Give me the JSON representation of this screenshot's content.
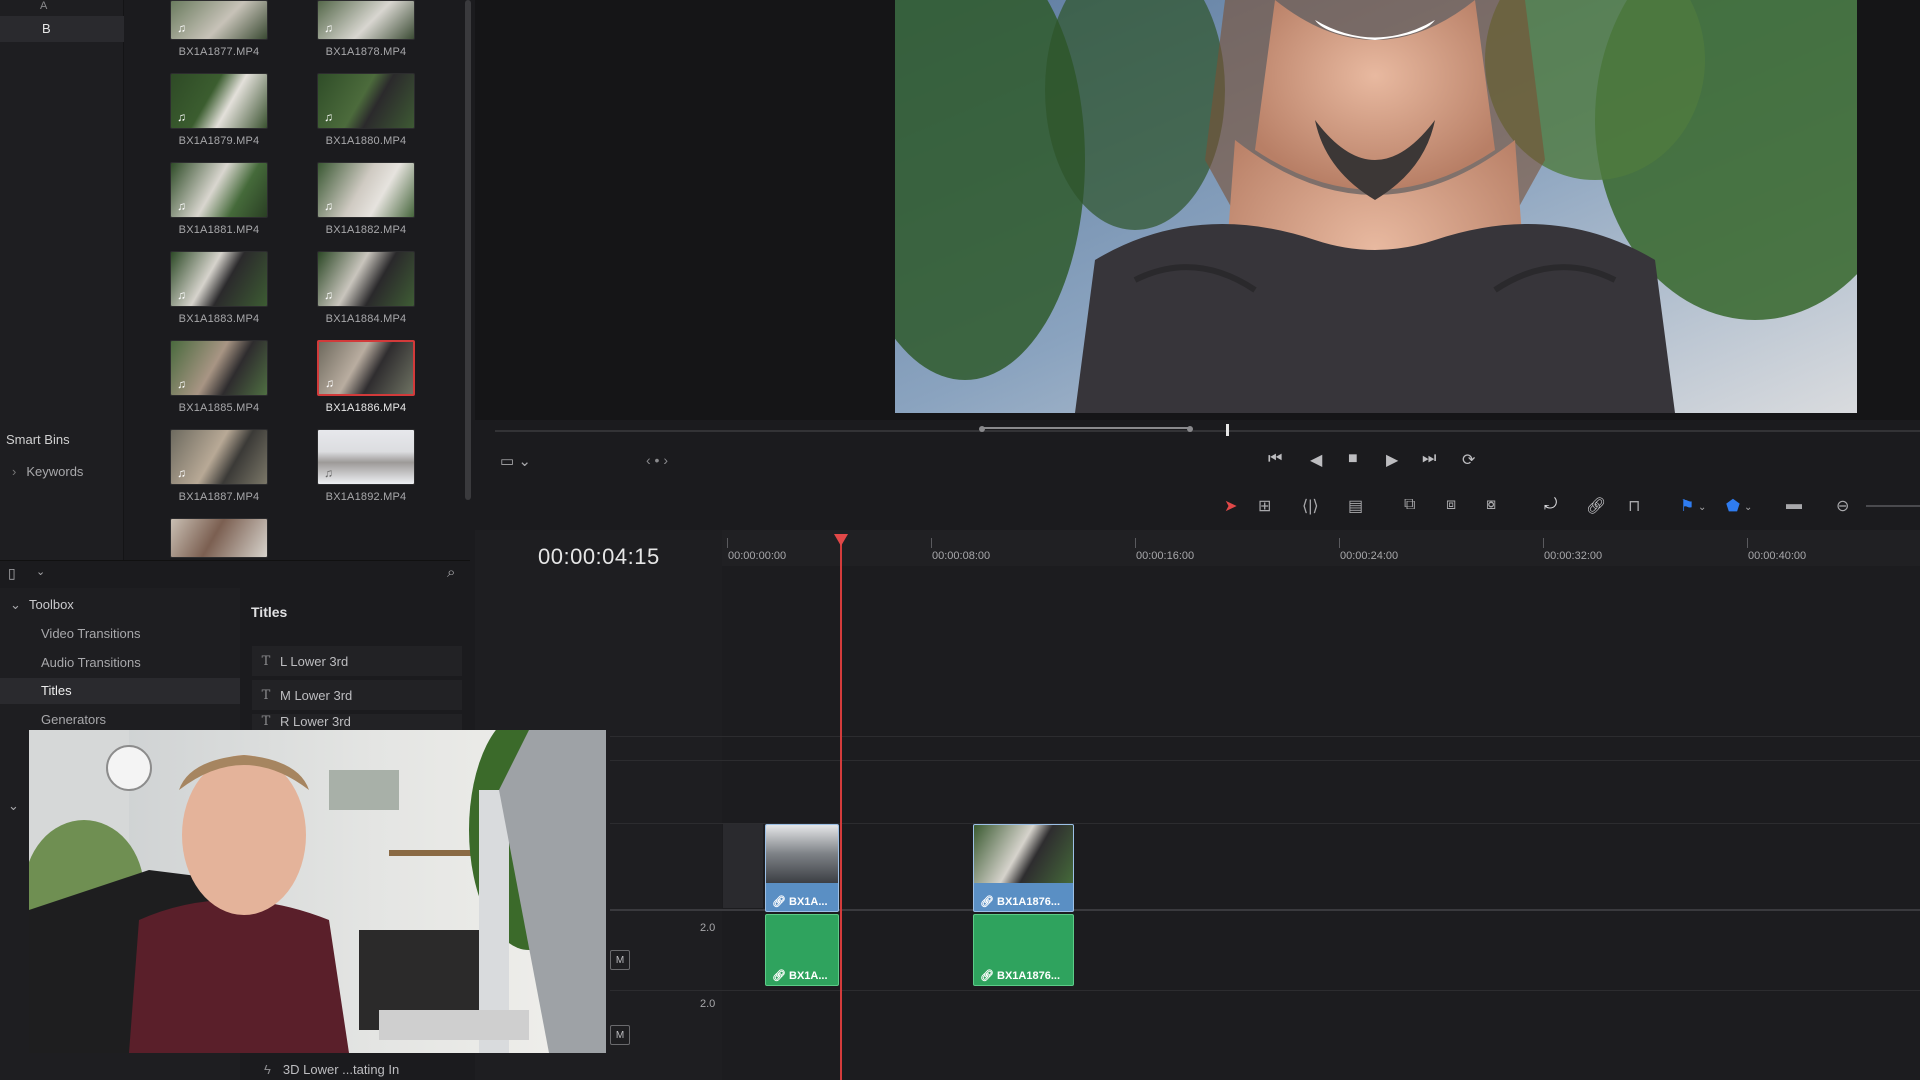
{
  "bins": {
    "items": [
      {
        "label": "A"
      },
      {
        "label": "B"
      }
    ],
    "smart_bins": "Smart Bins",
    "keywords": "Keywords"
  },
  "media": {
    "clips": [
      {
        "name": "BX1A1877.MP4"
      },
      {
        "name": "BX1A1878.MP4"
      },
      {
        "name": "BX1A1879.MP4"
      },
      {
        "name": "BX1A1880.MP4"
      },
      {
        "name": "BX1A1881.MP4"
      },
      {
        "name": "BX1A1882.MP4"
      },
      {
        "name": "BX1A1883.MP4"
      },
      {
        "name": "BX1A1884.MP4"
      },
      {
        "name": "BX1A1885.MP4"
      },
      {
        "name": "BX1A1886.MP4",
        "selected": true
      },
      {
        "name": "BX1A1887.MP4"
      },
      {
        "name": "BX1A1892.MP4"
      }
    ]
  },
  "effects": {
    "toolbox": "Toolbox",
    "tree": [
      "Video Transitions",
      "Audio Transitions",
      "Titles",
      "Generators"
    ],
    "list_header": "Titles",
    "titles": [
      "L Lower 3rd",
      "M Lower 3rd",
      "R Lower 3rd"
    ],
    "bottom_item": "3D Lower ...tating In"
  },
  "timeline": {
    "timecode": "00:00:04:15",
    "ruler": [
      "00:00:00:00",
      "00:00:08:00",
      "00:00:16:00",
      "00:00:24:00",
      "00:00:32:00",
      "00:00:40:00"
    ],
    "video_clips": [
      "BX1A...",
      "BX1A1876..."
    ],
    "audio_clips": [
      "BX1A...",
      "BX1A1876..."
    ],
    "audio_levels": [
      "2.0",
      "2.0"
    ],
    "mute_label": "M"
  },
  "colors": {
    "accent": "#d43c3c",
    "video_clip": "#5a8fc4",
    "audio_clip": "#2fa35e"
  },
  "icons": [
    "chevron-right-icon",
    "chevron-down-icon",
    "search-icon",
    "music-note-icon",
    "title-t-icon",
    "skip-back-icon",
    "step-back-icon",
    "stop-icon",
    "play-icon",
    "skip-forward-icon",
    "loop-icon",
    "selection-arrow-icon",
    "trim-icon",
    "blade-icon",
    "snap-icon",
    "link-icon",
    "lock-icon",
    "flag-icon",
    "marker-icon",
    "zoom-out-icon"
  ]
}
